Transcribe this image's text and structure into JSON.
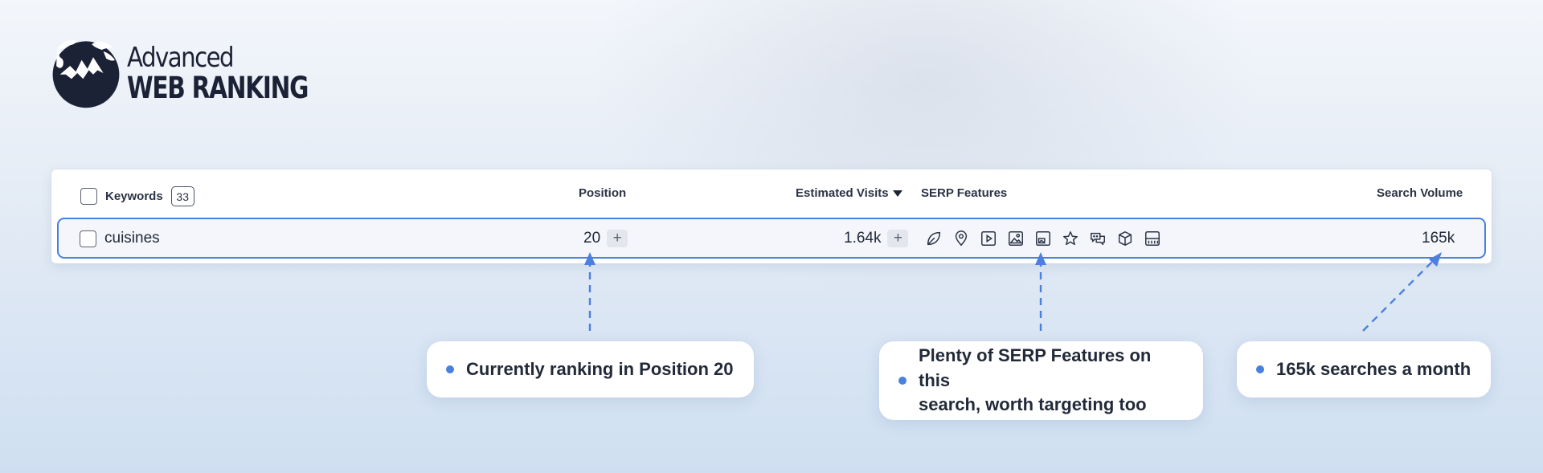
{
  "brand": {
    "line1": "Advanced",
    "line2": "WEB RANKING",
    "logo_icon": "globe-mountain-logo",
    "color": "#1b2235"
  },
  "table": {
    "headers": {
      "keywords": "Keywords",
      "keyword_count": "33",
      "position": "Position",
      "estimated_visits": "Estimated Visits",
      "serp_features": "SERP Features",
      "search_volume": "Search Volume"
    },
    "row": {
      "keyword": "cuisines",
      "position": "20",
      "estimated_visits": "1.64k",
      "plus_label": "+",
      "search_volume": "165k",
      "serp_features": [
        "featured-snippet-icon",
        "local-pack-icon",
        "video-icon",
        "images-icon",
        "thumbnail-icon",
        "reviews-icon",
        "people-also-ask-icon",
        "knowledge-panel-icon",
        "site-links-icon"
      ]
    },
    "highlight_color": "#4a80e0"
  },
  "callouts": {
    "position": "Currently ranking in Position 20",
    "serp_line1": "Plenty of SERP Features on this",
    "serp_line2": "search, worth targeting too",
    "volume": "165k searches a month"
  }
}
